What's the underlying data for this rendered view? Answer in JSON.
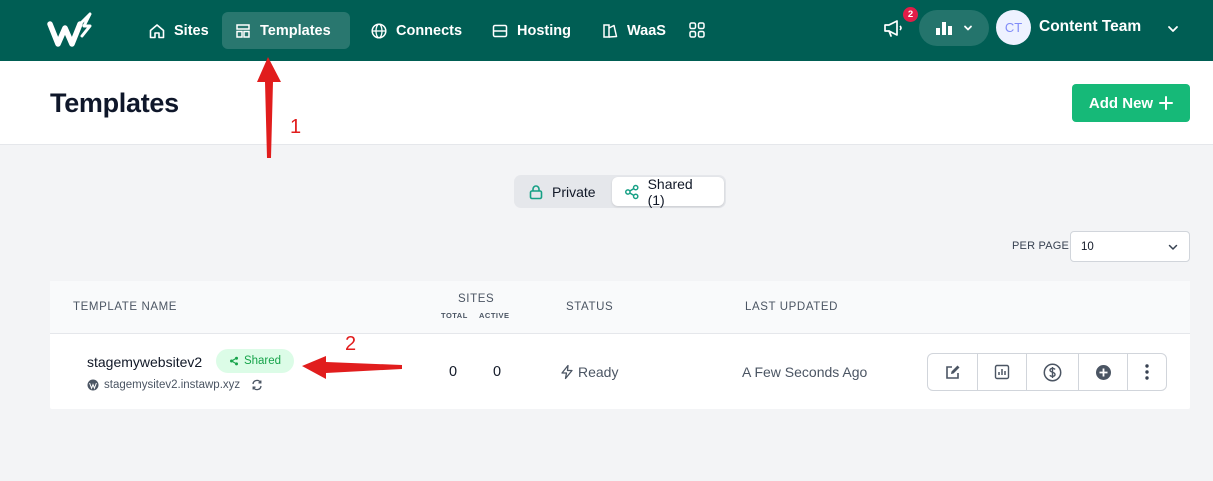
{
  "nav": {
    "items": [
      {
        "label": "Sites",
        "icon": "home-icon"
      },
      {
        "label": "Templates",
        "icon": "template-icon",
        "active": true
      },
      {
        "label": "Connects",
        "icon": "globe-icon"
      },
      {
        "label": "Hosting",
        "icon": "server-icon"
      },
      {
        "label": "WaaS",
        "icon": "waas-icon"
      }
    ],
    "apps_icon": "apps-grid-icon",
    "notifications_count": "2",
    "user_initials": "CT",
    "user_name": "Content Team"
  },
  "page": {
    "title": "Templates",
    "add_new_label": "Add New"
  },
  "filter": {
    "private_label": "Private",
    "shared_label": "Shared (1)",
    "selected": "shared"
  },
  "pagination": {
    "per_page_label": "PER PAGE",
    "per_page_value": "10"
  },
  "table": {
    "headers": {
      "name": "TEMPLATE NAME",
      "sites": "SITES",
      "total": "TOTAL",
      "active": "ACTIVE",
      "status": "STATUS",
      "updated": "LAST UPDATED"
    },
    "rows": [
      {
        "name": "stagemywebsitev2",
        "badge": "Shared",
        "url": "stagemysitev2.instawp.xyz",
        "total": "0",
        "active": "0",
        "status": "Ready",
        "updated": "A Few Seconds Ago"
      }
    ]
  },
  "annotations": {
    "first": "1",
    "second": "2",
    "color": "#e11d1d"
  },
  "colors": {
    "nav_bg": "#005e54",
    "accent": "#16b978",
    "badge_bg": "#dcfce7",
    "badge_text": "#16a34a"
  }
}
